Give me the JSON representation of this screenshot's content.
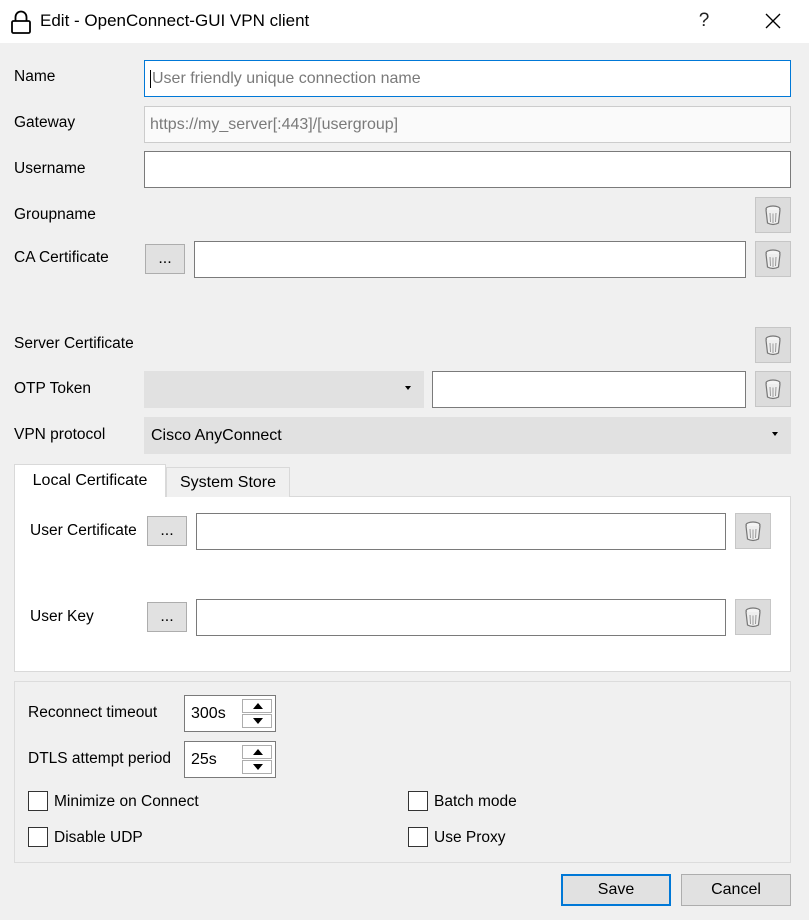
{
  "window": {
    "title": "Edit - OpenConnect-GUI VPN client",
    "help_label": "?",
    "icons": {
      "lock": "lock-icon",
      "close": "close-icon",
      "trash": "trash-icon"
    }
  },
  "form": {
    "name": {
      "label": "Name",
      "value": "",
      "placeholder": "User friendly unique connection name"
    },
    "gateway": {
      "label": "Gateway",
      "value": "",
      "placeholder": "https://my_server[:443]/[usergroup]"
    },
    "username": {
      "label": "Username",
      "value": ""
    },
    "groupname": {
      "label": "Groupname"
    },
    "ca_certificate": {
      "label": "CA Certificate",
      "browse_label": "...",
      "value": ""
    },
    "server_certificate": {
      "label": "Server Certificate"
    },
    "otp_token": {
      "label": "OTP Token",
      "selected": "",
      "value": ""
    },
    "vpn_protocol": {
      "label": "VPN protocol",
      "selected": "Cisco AnyConnect"
    }
  },
  "tabs": [
    {
      "label": "Local Certificate",
      "active": true
    },
    {
      "label": "System Store",
      "active": false
    }
  ],
  "local_certificate": {
    "user_certificate": {
      "label": "User Certificate",
      "browse_label": "...",
      "value": ""
    },
    "user_key": {
      "label": "User Key",
      "browse_label": "...",
      "value": ""
    }
  },
  "options": {
    "reconnect_timeout": {
      "label": "Reconnect timeout",
      "value": "300s"
    },
    "dtls_attempt_period": {
      "label": "DTLS attempt period",
      "value": "25s"
    },
    "minimize_on_connect": {
      "label": "Minimize on Connect",
      "checked": false
    },
    "batch_mode": {
      "label": "Batch mode",
      "checked": false
    },
    "disable_udp": {
      "label": "Disable UDP",
      "checked": false
    },
    "use_proxy": {
      "label": "Use Proxy",
      "checked": false
    }
  },
  "buttons": {
    "save": "Save",
    "cancel": "Cancel"
  },
  "colors": {
    "accent": "#0078d7",
    "background": "#f0f0f0",
    "button": "#e1e1e1"
  }
}
